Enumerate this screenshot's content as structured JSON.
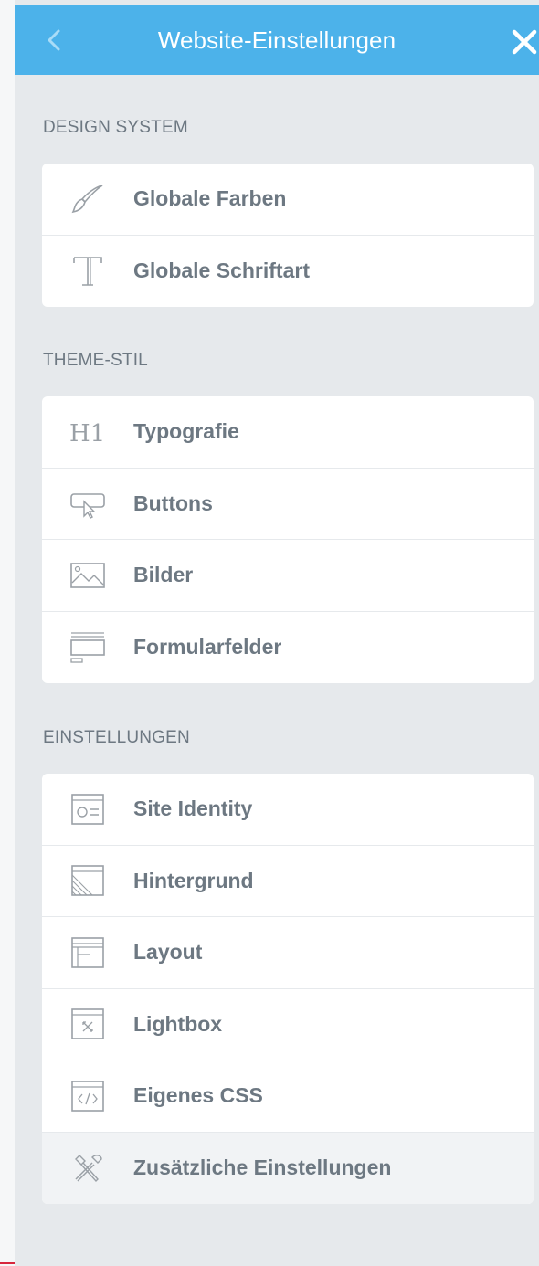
{
  "header": {
    "title": "Website-Einstellungen",
    "back_icon": "chevron-left-icon",
    "close_icon": "close-icon"
  },
  "sections": {
    "design_system": {
      "title": "DESIGN SYSTEM",
      "items": [
        {
          "label": "Globale Farben",
          "icon": "brush-icon"
        },
        {
          "label": "Globale Schriftart",
          "icon": "typeface-icon"
        }
      ]
    },
    "theme_stil": {
      "title": "THEME-STIL",
      "items": [
        {
          "label": "Typografie",
          "icon": "heading-icon"
        },
        {
          "label": "Buttons",
          "icon": "button-cursor-icon"
        },
        {
          "label": "Bilder",
          "icon": "image-icon"
        },
        {
          "label": "Formularfelder",
          "icon": "form-field-icon"
        }
      ]
    },
    "einstellungen": {
      "title": "EINSTELLUNGEN",
      "items": [
        {
          "label": "Site Identity",
          "icon": "site-identity-icon"
        },
        {
          "label": "Hintergrund",
          "icon": "background-icon"
        },
        {
          "label": "Layout",
          "icon": "layout-icon"
        },
        {
          "label": "Lightbox",
          "icon": "lightbox-icon"
        },
        {
          "label": "Eigenes CSS",
          "icon": "code-icon"
        },
        {
          "label": "Zusätzliche Einstellungen",
          "icon": "tools-icon"
        }
      ]
    }
  },
  "colors": {
    "header_bg": "#4cb2ea",
    "panel_bg": "#e6e9ec",
    "text": "#6d7882",
    "icon": "#9aa0a6"
  }
}
